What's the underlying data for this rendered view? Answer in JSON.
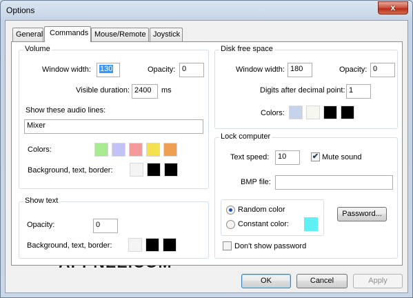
{
  "window": {
    "title": "Options",
    "close_glyph": "x"
  },
  "tabs": [
    "General",
    "Commands",
    "Mouse/Remote",
    "Joystick"
  ],
  "active_tab": "Commands",
  "volume": {
    "title": "Volume",
    "window_width_label": "Window width:",
    "window_width_value": "130",
    "opacity_label": "Opacity:",
    "opacity_value": "0",
    "visible_duration_label": "Visible duration:",
    "visible_duration_value": "2400",
    "visible_duration_unit": "ms",
    "audio_lines_label": "Show these audio lines:",
    "audio_lines_value": "Mixer",
    "colors_label": "Colors:",
    "colors": [
      "#a7ea8f",
      "#c2c2f7",
      "#f59a9a",
      "#f5e04f",
      "#ee9f51"
    ],
    "bg_label": "Background, text, border:",
    "bg_colors": [
      "#f4f4f4",
      "#000000",
      "#000000"
    ]
  },
  "show_text": {
    "title": "Show text",
    "opacity_label": "Opacity:",
    "opacity_value": "0",
    "bg_label": "Background, text, border:",
    "bg_colors": [
      "#f4f4f4",
      "#000000",
      "#000000"
    ]
  },
  "disk": {
    "title": "Disk free space",
    "window_width_label": "Window width:",
    "window_width_value": "180",
    "opacity_label": "Opacity:",
    "opacity_value": "0",
    "digits_label": "Digits after decimal point:",
    "digits_value": "1",
    "colors_label": "Colors:",
    "colors": [
      "#c6d3ea",
      "#f7f7f2",
      "#000000",
      "#000000"
    ]
  },
  "lock": {
    "title": "Lock computer",
    "text_speed_label": "Text  speed:",
    "text_speed_value": "10",
    "mute_label": "Mute sound",
    "mute_checked": true,
    "bmp_label": "BMP file:",
    "bmp_value": "",
    "random_label": "Random color",
    "constant_label": "Constant color:",
    "constant_color": "#5ff0f4",
    "password_button": "Password...",
    "dont_show_label": "Don't show password",
    "dont_show_checked": false
  },
  "buttons": {
    "ok": "OK",
    "cancel": "Cancel",
    "apply": "Apply"
  },
  "watermark": "APPNEE.COM"
}
